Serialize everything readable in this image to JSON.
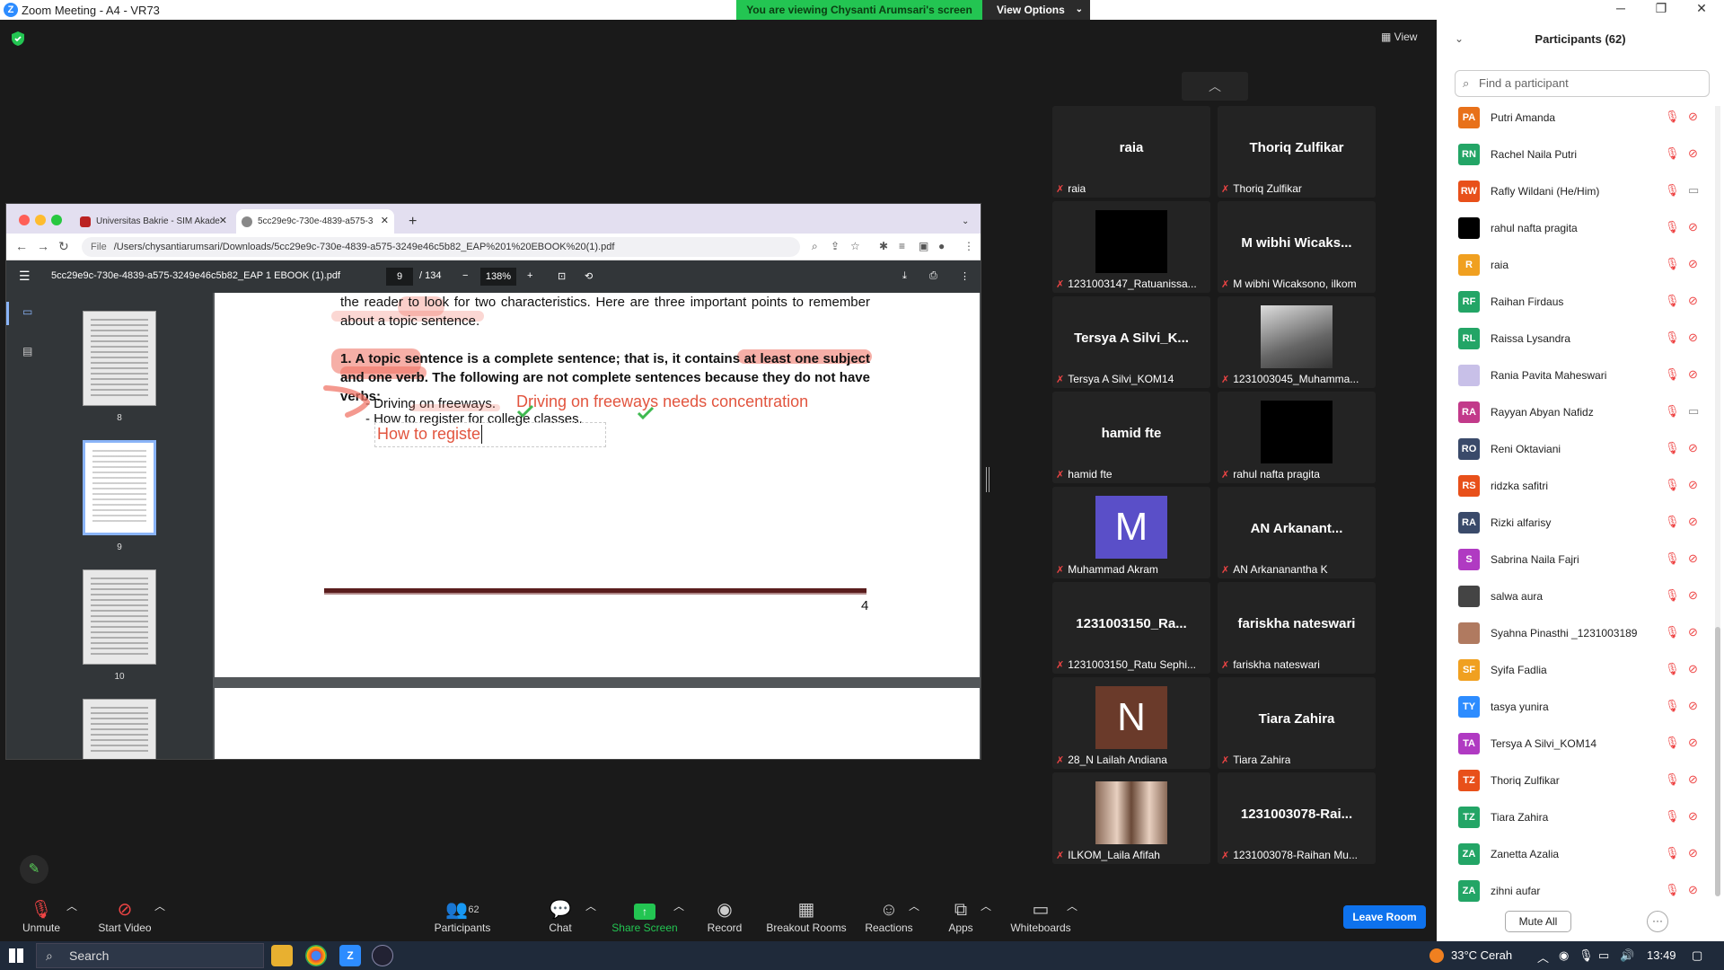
{
  "window": {
    "title": "Zoom Meeting - A4 - VR73",
    "controls": [
      "─",
      "❐",
      "✕"
    ]
  },
  "banner": {
    "viewing": "You are viewing Chysanti Arumsari's screen",
    "view_options": "View Options",
    "view": "View"
  },
  "browser": {
    "tabs": [
      {
        "label": "Universitas Bakrie - SIM Akade"
      },
      {
        "label": "5cc29e9c-730e-4839-a575-3"
      }
    ],
    "url_prefix": "File",
    "url": "/Users/chysantiarumsari/Downloads/5cc29e9c-730e-4839-a575-3249e46c5b82_EAP%201%20EBOOK%20(1).pdf"
  },
  "pdf": {
    "filename": "5cc29e9c-730e-4839-a575-3249e46c5b82_EAP 1 EBOOK (1).pdf",
    "page": "9",
    "total": "/ 134",
    "zoom": "138%",
    "thumbs": [
      "8",
      "9",
      "10"
    ],
    "text1": "the reader to look for two characteristics. Here are three important points to remember about a topic sentence.",
    "text2": "1. A topic sentence is a complete sentence; that is, it contains at least one subject and one verb. The following are not complete sentences because they do not have verbs:",
    "bullet1": "- Driving on freeways.",
    "bullet2": "- How to register for college classes.",
    "annot1": "Driving on freeways needs concentration",
    "annot2": "How to registe",
    "page_number": "4"
  },
  "gallery": [
    {
      "big": "raia",
      "name": "raia"
    },
    {
      "big": "Thoriq Zulfikar",
      "name": "Thoriq Zulfikar"
    },
    {
      "big": "",
      "name": "1231003147_Ratuanissa..."
    },
    {
      "big": "M wibhi Wicaks...",
      "name": "M wibhi Wicaksono, ilkom"
    },
    {
      "big": "Tersya A Silvi_K...",
      "name": "Tersya A Silvi_KOM14"
    },
    {
      "big": "",
      "name": "1231003045_Muhamma..."
    },
    {
      "big": "hamid fte",
      "name": "hamid fte"
    },
    {
      "big": "",
      "name": "rahul nafta pragita"
    },
    {
      "big": "M",
      "name": "Muhammad Akram"
    },
    {
      "big": "AN Arkanant...",
      "name": "AN Arkananantha K"
    },
    {
      "big": "1231003150_Ra...",
      "name": "1231003150_Ratu Sephi..."
    },
    {
      "big": "fariskha nateswari",
      "name": "fariskha nateswari"
    },
    {
      "big": "N",
      "name": "28_N Lailah Andiana"
    },
    {
      "big": "Tiara Zahira",
      "name": "Tiara Zahira"
    },
    {
      "big": "",
      "name": "ILKOM_Laila Afifah"
    },
    {
      "big": "1231003078-Rai...",
      "name": "1231003078-Raihan Mu..."
    }
  ],
  "participants": {
    "header": "Participants (62)",
    "search_placeholder": "Find a participant",
    "list": [
      {
        "initials": "PA",
        "name": "Putri Amanda",
        "color": "#e8711a",
        "video": "off"
      },
      {
        "initials": "RN",
        "name": "Rachel Naila Putri",
        "color": "#23a566",
        "video": "off"
      },
      {
        "initials": "RW",
        "name": "Rafly Wildani (He/Him)",
        "color": "#e8501a",
        "video": "on"
      },
      {
        "initials": "",
        "name": "rahul nafta pragita",
        "color": "#000000",
        "video": "off"
      },
      {
        "initials": "R",
        "name": "raia",
        "color": "#f0a020",
        "video": "off"
      },
      {
        "initials": "RF",
        "name": "Raihan Firdaus",
        "color": "#23a566",
        "video": "off"
      },
      {
        "initials": "RL",
        "name": "Raissa Lysandra",
        "color": "#23a566",
        "video": "off"
      },
      {
        "initials": "",
        "name": "Rania Pavita Maheswari",
        "color": "#c8c0e8",
        "video": "off"
      },
      {
        "initials": "RA",
        "name": "Rayyan Abyan Nafidz",
        "color": "#c23a8a",
        "video": "on"
      },
      {
        "initials": "RO",
        "name": "Reni Oktaviani",
        "color": "#3a4a6a",
        "video": "off"
      },
      {
        "initials": "RS",
        "name": "ridzka safitri",
        "color": "#e8501a",
        "video": "off"
      },
      {
        "initials": "RA",
        "name": "Rizki alfarisy",
        "color": "#3a4a6a",
        "video": "off"
      },
      {
        "initials": "S",
        "name": "Sabrina Naila Fajri",
        "color": "#b03ac2",
        "video": "off"
      },
      {
        "initials": "",
        "name": "salwa aura",
        "color": "#444444",
        "video": "off"
      },
      {
        "initials": "",
        "name": "Syahna Pinasthi _1231003189",
        "color": "#b07a60",
        "video": "off"
      },
      {
        "initials": "SF",
        "name": "Syifa Fadlia",
        "color": "#f0a020",
        "video": "off"
      },
      {
        "initials": "TY",
        "name": "tasya yunira",
        "color": "#2d8cff",
        "video": "off"
      },
      {
        "initials": "TA",
        "name": "Tersya A Silvi_KOM14",
        "color": "#b03ac2",
        "video": "off"
      },
      {
        "initials": "TZ",
        "name": "Thoriq Zulfikar",
        "color": "#e8501a",
        "video": "off"
      },
      {
        "initials": "TZ",
        "name": "Tiara Zahira",
        "color": "#23a566",
        "video": "off"
      },
      {
        "initials": "ZA",
        "name": "Zanetta Azalia",
        "color": "#23a566",
        "video": "off"
      },
      {
        "initials": "ZA",
        "name": "zihni aufar",
        "color": "#23a566",
        "video": "off"
      }
    ],
    "mute_all": "Mute All",
    "more": "···"
  },
  "controls": {
    "unmute": "Unmute",
    "start_video": "Start Video",
    "participants": "Participants",
    "participants_count": "62",
    "chat": "Chat",
    "share_screen": "Share Screen",
    "record": "Record",
    "breakout": "Breakout Rooms",
    "reactions": "Reactions",
    "apps": "Apps",
    "whiteboards": "Whiteboards",
    "leave": "Leave Room"
  },
  "taskbar": {
    "search": "Search",
    "weather": "33°C  Cerah",
    "time": "13:49"
  }
}
